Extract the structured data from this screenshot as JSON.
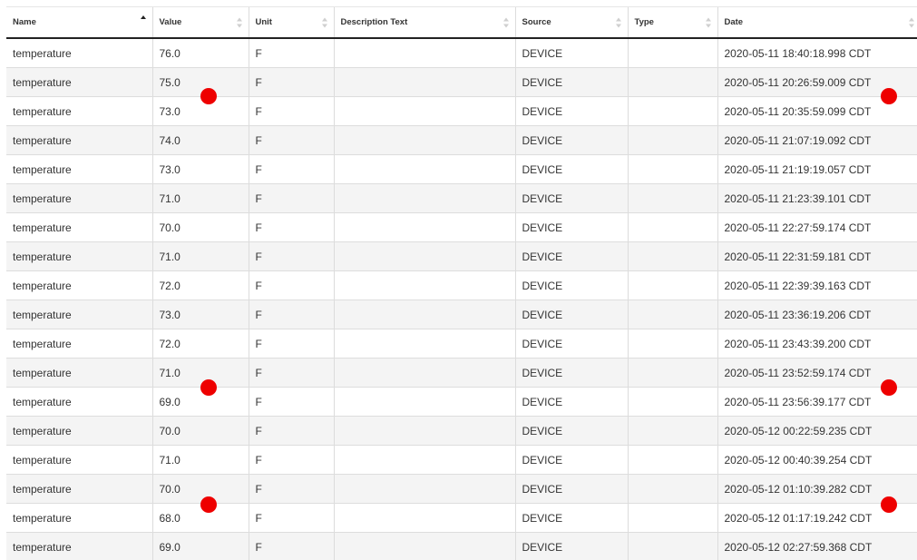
{
  "table": {
    "columns": [
      {
        "label": "Name",
        "sort": "asc"
      },
      {
        "label": "Value",
        "sort": "none"
      },
      {
        "label": "Unit",
        "sort": "none"
      },
      {
        "label": "Description Text",
        "sort": "none"
      },
      {
        "label": "Source",
        "sort": "none"
      },
      {
        "label": "Type",
        "sort": "none"
      },
      {
        "label": "Date",
        "sort": "none"
      }
    ],
    "rows": [
      {
        "name": "temperature",
        "value": "76.0",
        "unit": "F",
        "description": "",
        "source": "DEVICE",
        "type": "",
        "date": "2020-05-11 18:40:18.998 CDT"
      },
      {
        "name": "temperature",
        "value": "75.0",
        "unit": "F",
        "description": "",
        "source": "DEVICE",
        "type": "",
        "date": "2020-05-11 20:26:59.009 CDT"
      },
      {
        "name": "temperature",
        "value": "73.0",
        "unit": "F",
        "description": "",
        "source": "DEVICE",
        "type": "",
        "date": "2020-05-11 20:35:59.099 CDT"
      },
      {
        "name": "temperature",
        "value": "74.0",
        "unit": "F",
        "description": "",
        "source": "DEVICE",
        "type": "",
        "date": "2020-05-11 21:07:19.092 CDT"
      },
      {
        "name": "temperature",
        "value": "73.0",
        "unit": "F",
        "description": "",
        "source": "DEVICE",
        "type": "",
        "date": "2020-05-11 21:19:19.057 CDT"
      },
      {
        "name": "temperature",
        "value": "71.0",
        "unit": "F",
        "description": "",
        "source": "DEVICE",
        "type": "",
        "date": "2020-05-11 21:23:39.101 CDT"
      },
      {
        "name": "temperature",
        "value": "70.0",
        "unit": "F",
        "description": "",
        "source": "DEVICE",
        "type": "",
        "date": "2020-05-11 22:27:59.174 CDT"
      },
      {
        "name": "temperature",
        "value": "71.0",
        "unit": "F",
        "description": "",
        "source": "DEVICE",
        "type": "",
        "date": "2020-05-11 22:31:59.181 CDT"
      },
      {
        "name": "temperature",
        "value": "72.0",
        "unit": "F",
        "description": "",
        "source": "DEVICE",
        "type": "",
        "date": "2020-05-11 22:39:39.163 CDT"
      },
      {
        "name": "temperature",
        "value": "73.0",
        "unit": "F",
        "description": "",
        "source": "DEVICE",
        "type": "",
        "date": "2020-05-11 23:36:19.206 CDT"
      },
      {
        "name": "temperature",
        "value": "72.0",
        "unit": "F",
        "description": "",
        "source": "DEVICE",
        "type": "",
        "date": "2020-05-11 23:43:39.200 CDT"
      },
      {
        "name": "temperature",
        "value": "71.0",
        "unit": "F",
        "description": "",
        "source": "DEVICE",
        "type": "",
        "date": "2020-05-11 23:52:59.174 CDT"
      },
      {
        "name": "temperature",
        "value": "69.0",
        "unit": "F",
        "description": "",
        "source": "DEVICE",
        "type": "",
        "date": "2020-05-11 23:56:39.177 CDT"
      },
      {
        "name": "temperature",
        "value": "70.0",
        "unit": "F",
        "description": "",
        "source": "DEVICE",
        "type": "",
        "date": "2020-05-12 00:22:59.235 CDT"
      },
      {
        "name": "temperature",
        "value": "71.0",
        "unit": "F",
        "description": "",
        "source": "DEVICE",
        "type": "",
        "date": "2020-05-12 00:40:39.254 CDT"
      },
      {
        "name": "temperature",
        "value": "70.0",
        "unit": "F",
        "description": "",
        "source": "DEVICE",
        "type": "",
        "date": "2020-05-12 01:10:39.282 CDT"
      },
      {
        "name": "temperature",
        "value": "68.0",
        "unit": "F",
        "description": "",
        "source": "DEVICE",
        "type": "",
        "date": "2020-05-12 01:17:19.242 CDT"
      },
      {
        "name": "temperature",
        "value": "69.0",
        "unit": "F",
        "description": "",
        "source": "DEVICE",
        "type": "",
        "date": "2020-05-12 02:27:59.368 CDT"
      }
    ]
  },
  "colors": {
    "marker": "#ee0000",
    "header_rule": "#222222",
    "row_alt": "#f4f4f4"
  },
  "icons": {
    "sort_ascending": "sort-ascending-icon",
    "sort_neutral": "sort-neutral-icon",
    "annotation_marker": "red-dot-marker"
  }
}
